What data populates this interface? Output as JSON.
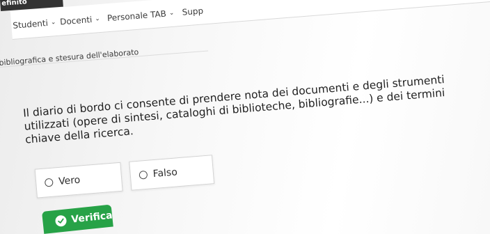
{
  "app": {
    "title": "efinito"
  },
  "nav": {
    "items": [
      {
        "label": "Studenti"
      },
      {
        "label": "Docenti"
      },
      {
        "label": "Personale TAB"
      },
      {
        "label": "Supp"
      }
    ]
  },
  "section": {
    "subtitle": "bibliografica e stesura dell'elaborato"
  },
  "question": {
    "text": "Il diario di bordo ci consente di prendere nota dei documenti e degli strumenti utilizzati (opere di sintesi, cataloghi di biblioteche, bibliografie...) e dei termini chiave della ricerca."
  },
  "options": [
    {
      "label": "Vero",
      "selected": false
    },
    {
      "label": "Falso",
      "selected": false
    }
  ],
  "actions": {
    "verify_label": "Verifica"
  },
  "colors": {
    "accent": "#27a247"
  }
}
